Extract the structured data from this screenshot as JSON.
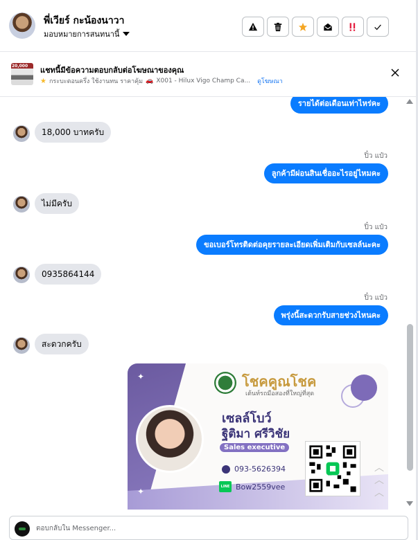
{
  "header": {
    "name": "พี่เวียร์ กะน้องนาวา",
    "assign_label": "มอบหมายการสนทนานี้",
    "actions": [
      {
        "icon": "alert-icon"
      },
      {
        "icon": "trash-icon"
      },
      {
        "icon": "star-icon"
      },
      {
        "icon": "mark-unread-icon"
      },
      {
        "icon": "spam-icon"
      },
      {
        "icon": "check-icon"
      }
    ]
  },
  "ad_banner": {
    "title": "แชทนี้มีข้อความตอบกลับต่อโฆษณาของคุณ",
    "subtitle": "กระบะตอนครึ่ง ใช้งานทน ราคาคุ้ม",
    "car_model": "X001 - Hilux Vigo Champ Ca...",
    "link_label": "ดูโฆษณา",
    "thumb_text": "20,000"
  },
  "messages": [
    {
      "dir": "out",
      "text": "รายได้ต่อเดือนเท่าไหร่คะ"
    },
    {
      "dir": "in",
      "text": "18,000 บาทครับ"
    },
    {
      "dir": "out",
      "sender": "ปิ๋ว แป๋ว",
      "text": "ลูกค้ามีผ่อนสินเชื่ออะไรอยู่ไหมคะ"
    },
    {
      "dir": "in",
      "text": "ไม่มีครับ"
    },
    {
      "dir": "out",
      "sender": "ปิ๋ว แป๋ว",
      "text": "ขอเบอร์โทรติดต่อคุยรายละเอียดเพิ่มเติมกับเซลล์นะคะ"
    },
    {
      "dir": "in",
      "text": "0935864144"
    },
    {
      "dir": "out",
      "sender": "ปิ๋ว แป๋ว",
      "text": "พรุ่งนี้สะดวกรับสายช่วงไหนคะ"
    },
    {
      "dir": "in",
      "text": "สะดวกครับ"
    }
  ],
  "card": {
    "brand": "โชคคูณโชค",
    "tagline": "เต้นท์รถมือสองที่ใหญ่ที่สุด",
    "role": "เซลล์โบว์",
    "name": "ฐิติมา ศรีวิชัย",
    "position": "Sales executive",
    "phone": "093-5626394",
    "line_id": "Bow2559vee",
    "line_label": "LINE"
  },
  "reply": {
    "placeholder": "ตอบกลับใน Messenger..."
  },
  "colors": {
    "outgoing_bubble": "#0a7cff",
    "incoming_bubble": "#e4e6eb",
    "link": "#1877f2",
    "star": "#f5a623",
    "spam": "#e41e3f"
  }
}
